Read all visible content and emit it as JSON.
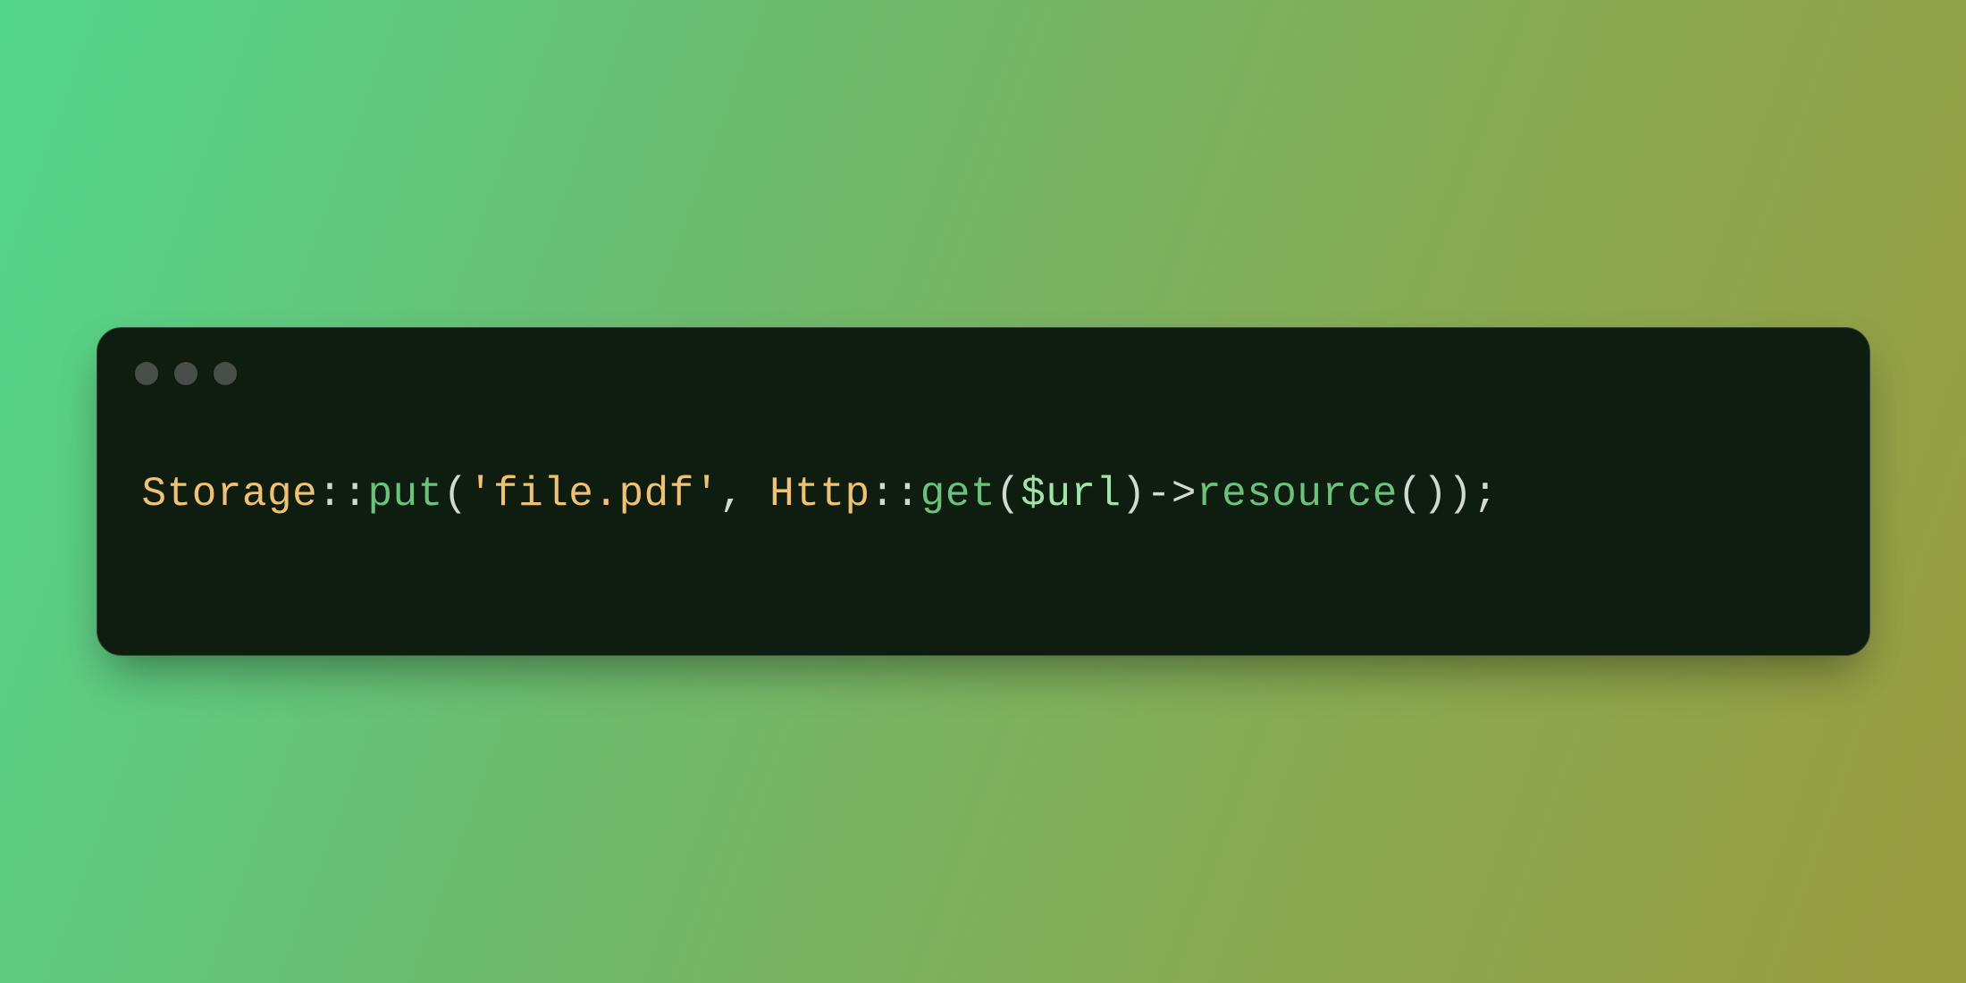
{
  "code": {
    "class1": "Storage",
    "scope1": "::",
    "method1": "put",
    "paren_open1": "(",
    "string1": "'file.pdf'",
    "comma1": ",",
    "space1": " ",
    "class2": "Http",
    "scope2": "::",
    "method2": "get",
    "paren_open2": "(",
    "var1": "$url",
    "paren_close2": ")",
    "arrow1": "->",
    "method3": "resource",
    "paren_open3": "(",
    "paren_close3": ")",
    "paren_close1": ")",
    "semi": ";"
  }
}
